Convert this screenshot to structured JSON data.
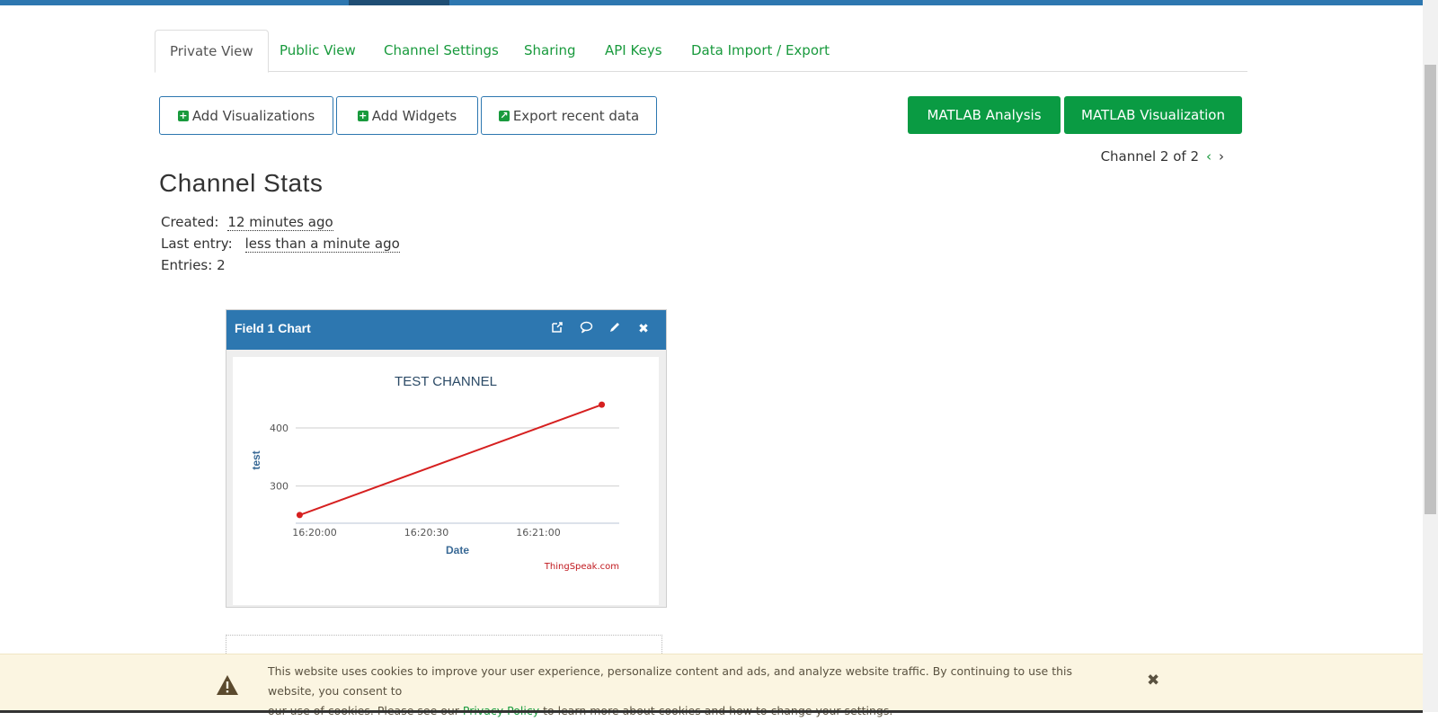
{
  "tabs": [
    {
      "label": "Private View"
    },
    {
      "label": "Public View"
    },
    {
      "label": "Channel Settings"
    },
    {
      "label": "Sharing"
    },
    {
      "label": "API Keys"
    },
    {
      "label": "Data Import / Export"
    }
  ],
  "actions": {
    "add_visualizations": "Add Visualizations",
    "add_widgets": "Add Widgets",
    "export_recent": "Export recent data",
    "matlab_analysis": "MATLAB Analysis",
    "matlab_visualization": "MATLAB Visualization"
  },
  "channel_nav": {
    "label": "Channel 2 of 2"
  },
  "stats": {
    "title": "Channel Stats",
    "created_label": "Created:",
    "created_value": "12 minutes ago",
    "last_entry_label": "Last entry:",
    "last_entry_value": "less than a minute ago",
    "entries_label": "Entries: 2"
  },
  "widget": {
    "title": "Field 1 Chart"
  },
  "chart_data": {
    "type": "line",
    "title": "TEST CHANNEL",
    "xlabel": "Date",
    "ylabel": "test",
    "credit": "ThingSpeak.com",
    "x_ticks": [
      "16:20:00",
      "16:20:30",
      "16:21:00"
    ],
    "y_ticks": [
      300,
      400
    ],
    "series": [
      {
        "color": "#d62020",
        "points": [
          {
            "x": "16:19:56",
            "y": 250
          },
          {
            "x": "16:21:17",
            "y": 440
          }
        ]
      }
    ],
    "ylim": [
      240,
      450
    ],
    "grid": true
  },
  "cookie": {
    "text_1": "This website uses cookies to improve your user experience, personalize content and ads, and analyze website traffic. By continuing to use this website, you consent to",
    "text_2a": "our use of cookies. Please see our ",
    "link": "Privacy Policy",
    "text_2b": " to learn more about cookies and how to change your settings."
  },
  "colors": {
    "accent_green": "#0a9b43",
    "header_blue": "#2d77b0",
    "line_red": "#d62020"
  }
}
